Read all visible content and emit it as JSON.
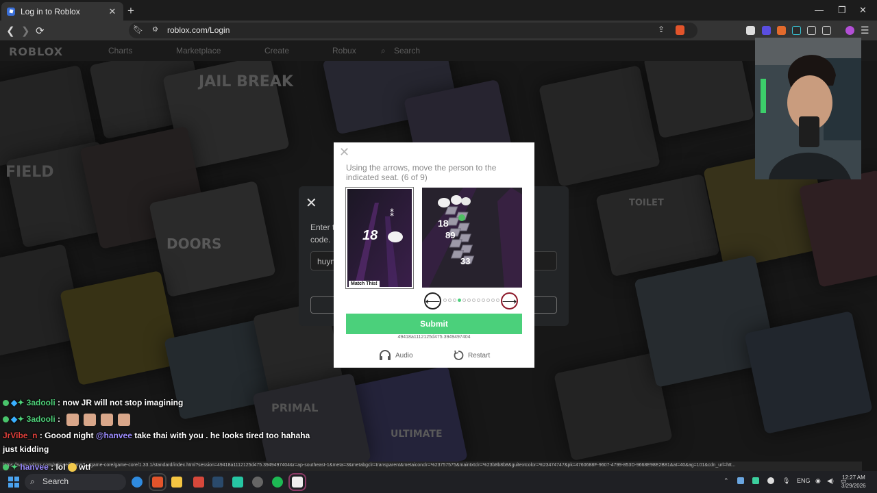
{
  "browser": {
    "tab_title": "Log in to Roblox",
    "tab_close": "✕",
    "new_tab": "+",
    "url": "roblox.com/Login",
    "window_minimize": "—",
    "window_restore": "❐",
    "window_close": "✕"
  },
  "roblox_nav": {
    "logo": "ROBLOX",
    "links": [
      "Charts",
      "Marketplace",
      "Create",
      "Robux"
    ],
    "search_placeholder": "Search"
  },
  "login_dialog": {
    "close": "✕",
    "text_line1": "Enter t",
    "text_line2": "code.",
    "input_value": "huyn"
  },
  "captcha": {
    "close": "✕",
    "prompt": "Using the arrows, move the person to the indicated seat. (6 of 9)",
    "reference_label": "Match This!",
    "reference_number": "18",
    "seat_numbers": [
      "18",
      "89",
      "33"
    ],
    "left_arrow": "⟵",
    "right_arrow": "⟶",
    "dots_total": 12,
    "dot_active": 3,
    "submit_label": "Submit",
    "session_id": "49418a1112125d475.3949497404",
    "audio_label": "Audio",
    "restart_label": "Restart",
    "accent_color": "#4bd07b"
  },
  "chat": {
    "messages": [
      {
        "user": "3adooli",
        "user_color": "#4fd27a",
        "text": ": now JR will not stop imagining"
      },
      {
        "user": "3adooli",
        "user_color": "#4fd27a",
        "text": ":"
      },
      {
        "user": "JrVibe_n",
        "user_color": "#e0403b",
        "text": ": Goood night",
        "mention": "@hanvee",
        "text2": " take thai with you . he looks tired too hahaha"
      },
      {
        "user": "",
        "text": "just kidding"
      },
      {
        "user": "hanvee",
        "user_color": "#7d6cf5",
        "text": ": lol",
        "text2": " wtf"
      }
    ]
  },
  "status_url": "https://www.roblox.com/arkose/iframe?... game-core/game-core/1.33.1/standard/index.html?session=49418a1112125d475.3949497404&r=ap-southeast-1&meta=3&metabgclr=transparent&metaiconclr=%23757575&maintxtclr=%23b8b8b8&guitextcolor=%23474747&pk=4760688F-9607-4799-853D-9668E98E2B81&at=40&ag=101&cdn_url=htt...",
  "taskbar": {
    "search_label": "Search",
    "lang": "ENG",
    "time": "12:27 AM",
    "date": "3/29/2026"
  }
}
